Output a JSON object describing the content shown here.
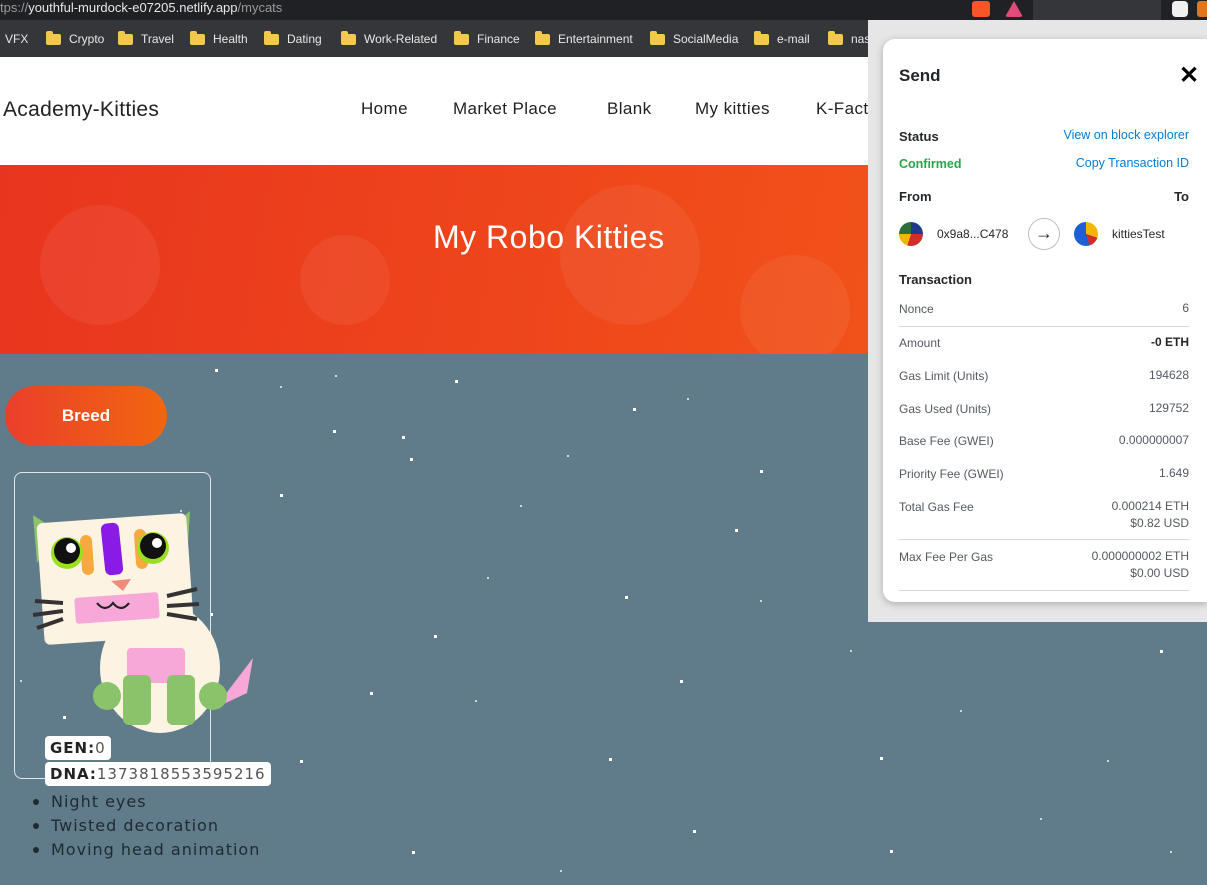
{
  "browser": {
    "url_prefix": "tps://",
    "url_host": "youthful-murdock-e07205.netlify.app",
    "url_path": "/mycats"
  },
  "bookmarks": [
    {
      "label": "VFX",
      "folder": false
    },
    {
      "label": "Crypto",
      "folder": true
    },
    {
      "label": "Travel",
      "folder": true
    },
    {
      "label": "Health",
      "folder": true
    },
    {
      "label": "Dating",
      "folder": true
    },
    {
      "label": "Work-Related",
      "folder": true
    },
    {
      "label": "Finance",
      "folder": true
    },
    {
      "label": "Entertainment",
      "folder": true
    },
    {
      "label": "SocialMedia",
      "folder": true
    },
    {
      "label": "e-mail",
      "folder": true
    },
    {
      "label": "nas",
      "folder": true
    }
  ],
  "site": {
    "brand": "Academy-Kitties",
    "nav": [
      "Home",
      "Market Place",
      "Blank",
      "My kitties",
      "K-Fact"
    ],
    "hero_title": "My Robo Kitties",
    "breed_label": "Breed"
  },
  "cat": {
    "gen_key": "GEN:",
    "gen_value": "0",
    "dna_key": "DNA:",
    "dna_value": "1373818553595216",
    "attributes": [
      "Night eyes",
      "Twisted decoration",
      "Moving head animation"
    ],
    "colors": {
      "head": "#fdf3e2",
      "ears": "#8bc36a",
      "mouth": "#f7a8d8",
      "decoration_center": "#8a1ae6",
      "decoration_sides": "#f7a940",
      "tail": "#f7a8d8",
      "paws": "#8bc36a"
    }
  },
  "metamask": {
    "title": "Send",
    "close_icon": "close-icon",
    "status_label": "Status",
    "status_value": "Confirmed",
    "view_explorer": "View on block explorer",
    "copy_tx": "Copy Transaction ID",
    "from_label": "From",
    "to_label": "To",
    "from_address": "0x9a8...C478",
    "to_address": "kittiesTest",
    "transaction_label": "Transaction",
    "rows": [
      {
        "label": "Nonce",
        "value": "6"
      },
      {
        "label": "Amount",
        "value": "-0 ETH"
      },
      {
        "label": "Gas Limit (Units)",
        "value": "194628"
      },
      {
        "label": "Gas Used (Units)",
        "value": "129752"
      },
      {
        "label": "Base Fee (GWEI)",
        "value": "0.000000007"
      },
      {
        "label": "Priority Fee (GWEI)",
        "value": "1.649"
      },
      {
        "label": "Total Gas Fee",
        "value": "0.000214 ETH",
        "value2": "$0.82 USD"
      },
      {
        "label": "Max Fee Per Gas",
        "value": "0.000000002 ETH",
        "value2": "$0.00 USD"
      }
    ],
    "colors": {
      "link": "#037dd6",
      "confirmed": "#28a745"
    }
  }
}
